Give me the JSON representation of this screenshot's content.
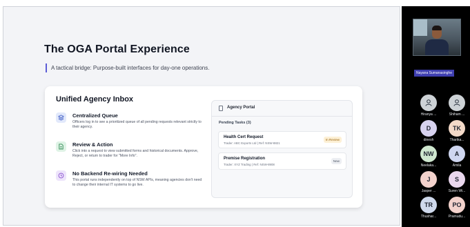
{
  "slide": {
    "title": "The OGA Portal Experience",
    "subtitle": "A tactical bridge: Purpose-built interfaces for day-one operations."
  },
  "inbox": {
    "heading": "Unified Agency Inbox",
    "features": [
      {
        "icon": "layers-icon",
        "title": "Centralized Queue",
        "description": "Officers log in to see a prioritized queue of all pending requests relevant strictly to their agency."
      },
      {
        "icon": "document-icon",
        "title": "Review & Action",
        "description": "Click into a request to view submitted forms and historical documents. Approve, Reject, or return to trader for \"More Info\"."
      },
      {
        "icon": "clock-icon",
        "title": "No Backend Re-wiring Needed",
        "description": "This portal runs independently on top of NSW APIs, meaning agencies don't need to change their internal IT systems to go live."
      }
    ]
  },
  "portal": {
    "title": "Agency Portal",
    "pending_label": "Pending Tasks (3)",
    "tasks": [
      {
        "name": "Health Cert Request",
        "meta": "Trader: ABC Exports Ltd | Ref: NSW-8821",
        "status": "In Review"
      },
      {
        "name": "Premise Registration",
        "meta": "Trader: XYZ Trading | Ref: NSW-8908",
        "status": "New"
      }
    ]
  },
  "meeting": {
    "presenter_name": "Nayana Sumanasinghe",
    "participants": [
      {
        "initials": "",
        "name": "Hiranya ...",
        "avatar": "person-icon",
        "color": "#cdd2d6"
      },
      {
        "initials": "",
        "name": "Shiham ...",
        "avatar": "person-icon",
        "color": "#cdd2d6"
      },
      {
        "initials": "D",
        "name": "dinesh",
        "color": "#d7d2ef"
      },
      {
        "initials": "TK",
        "name": "Tharika...",
        "color": "#f3d9c8"
      },
      {
        "initials": "NW",
        "name": "Neelaka...",
        "color": "#cfe7cf"
      },
      {
        "initials": "A",
        "name": "Amila",
        "color": "#cfd6f0"
      },
      {
        "initials": "J",
        "name": "Jasper ...",
        "color": "#f3d2cc"
      },
      {
        "initials": "S",
        "name": "Suren Wi...",
        "color": "#ead7ee"
      },
      {
        "initials": "TR",
        "name": "Thushar...",
        "color": "#cfd9ec"
      },
      {
        "initials": "PO",
        "name": "Pramudu...",
        "color": "#f3d2cc"
      }
    ]
  },
  "colors": {
    "accent": "#5b5bd6",
    "badge_review_bg": "#fdf0d5",
    "badge_review_fg": "#9a6510",
    "badge_new_bg": "#eceef2"
  }
}
